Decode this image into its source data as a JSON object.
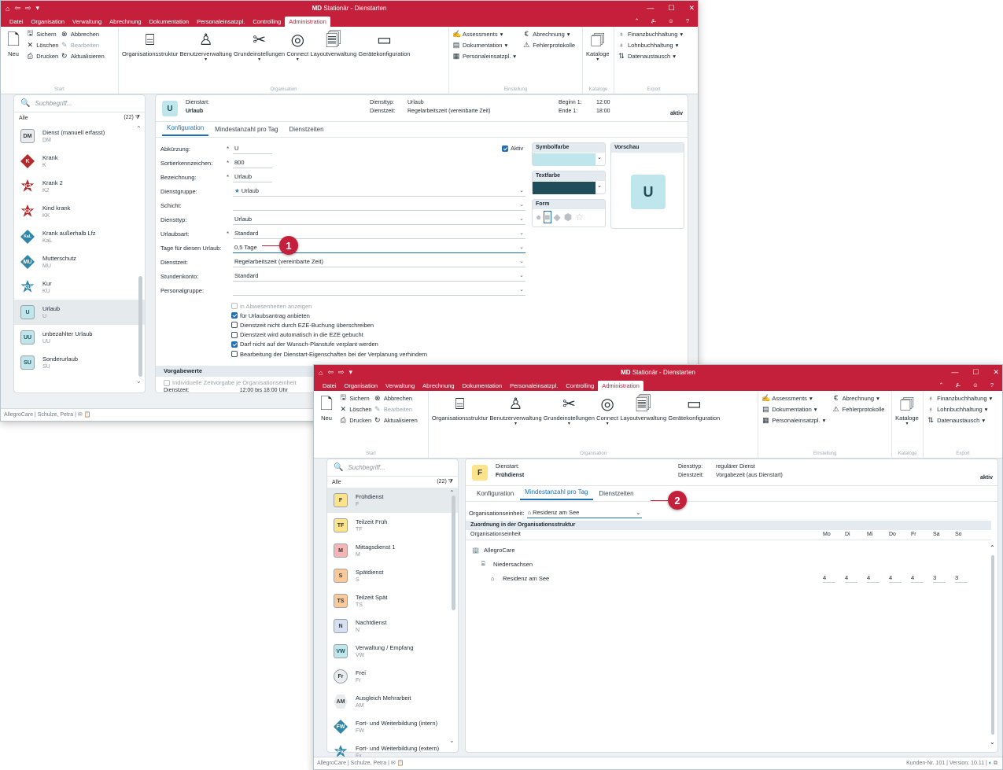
{
  "app": {
    "title_bold": "MD",
    "title_rest": " Stationär - Dienstarten",
    "menu": [
      "Datei",
      "Organisation",
      "Verwaltung",
      "Abrechnung",
      "Dokumentation",
      "Personaleinsatzpl.",
      "Controlling",
      "Administration"
    ],
    "menu_active": "Administration",
    "ribbon": {
      "neu": "Neu",
      "sichern": "Sichern",
      "abbrechen": "Abbrechen",
      "loeschen": "Löschen",
      "bearbeiten": "Bearbeiten",
      "drucken": "Drucken",
      "aktualisieren": "Aktualisieren",
      "group_start": "Start",
      "organisationsstruktur": "Organisationsstruktur",
      "benutzerverwaltung": "Benutzerverwaltung",
      "grundeinstellungen": "Grundeinstellungen",
      "connect": "Connect",
      "layoutverwaltung": "Layoutverwaltung",
      "geraetekonfiguration": "Gerätekonfiguration",
      "group_organisation": "Organisation",
      "assessments": "Assessments",
      "dokumentation": "Dokumentation",
      "personaleinsatzpl": "Personaleinsatzpl.",
      "abrechnung": "Abrechnung",
      "fehlerprotokolle": "Fehlerprotokolle",
      "group_einstellung": "Einstellung",
      "kataloge": "Kataloge",
      "group_kataloge": "Kataloge",
      "finanzbuchhaltung": "Finanzbuchhaltung",
      "lohnbuchhaltung": "Lohnbuchhaltung",
      "datenaustausch": "Datenaustausch",
      "group_export": "Export"
    },
    "status_user": "AllegroCare | Schulze, Petra |",
    "status_right": "Kunden-Nr. 101 | Version: 10.11 |"
  },
  "search_placeholder": "Suchbegriff...",
  "filter_label": "Alle",
  "filter_count": "(22)",
  "w1": {
    "list": [
      {
        "name": "Dienst (manuell erfasst)",
        "code": "DM",
        "badge": "DM",
        "shape": "square",
        "bg": "#e9ecee",
        "fg": "#333333"
      },
      {
        "name": "Krank",
        "code": "K",
        "badge": "K",
        "shape": "diamond",
        "bg": "#b32a2a",
        "fg": "#ffffff"
      },
      {
        "name": "Krank 2",
        "code": "K2",
        "badge": "K2",
        "shape": "star",
        "bg": "#b32a2a",
        "fg": "#ffffff"
      },
      {
        "name": "Kind krank",
        "code": "KK",
        "badge": "KK",
        "shape": "star",
        "bg": "#b32a2a",
        "fg": "#ffffff"
      },
      {
        "name": "Krank außerhalb Lfz",
        "code": "KaL",
        "badge": "KaL",
        "shape": "diamond",
        "bg": "#2f86a6",
        "fg": "#ffffff"
      },
      {
        "name": "Mutterschutz",
        "code": "MU",
        "badge": "MU",
        "shape": "diamond",
        "bg": "#2f86a6",
        "fg": "#ffffff"
      },
      {
        "name": "Kur",
        "code": "KU",
        "badge": "KU",
        "shape": "star",
        "bg": "#2f86a6",
        "fg": "#ffffff"
      },
      {
        "name": "Urlaub",
        "code": "U",
        "badge": "U",
        "shape": "square",
        "bg": "#bfe6ea",
        "fg": "#1f4e5a"
      },
      {
        "name": "unbezahlter Urlaub",
        "code": "UU",
        "badge": "UU",
        "shape": "square",
        "bg": "#bfe6ea",
        "fg": "#1f4e5a"
      },
      {
        "name": "Sonderurlaub",
        "code": "SU",
        "badge": "SU",
        "shape": "square",
        "bg": "#bfe6ea",
        "fg": "#1f4e5a"
      }
    ],
    "selected_index": 7,
    "header": {
      "badge": "U",
      "dienstart_label": "Dienstart:",
      "dienstart_value": "Urlaub",
      "diensttyp_label": "Diensttyp:",
      "diensttyp_value": "Urlaub",
      "dienstzeit_label": "Dienstzeit:",
      "dienstzeit_value": "Regelarbeitszeit (vereinbarte Zeit)",
      "beginn_label": "Beginn 1:",
      "beginn_value": "12:00",
      "ende_label": "Ende 1:",
      "ende_value": "18:00",
      "status": "aktiv"
    },
    "tabs": [
      "Konfiguration",
      "Mindestanzahl pro Tag",
      "Dienstzeiten"
    ],
    "active_tab": 0,
    "form": {
      "abkuerzung_label": "Abkürzung:",
      "abkuerzung": "U",
      "aktiv_label": "Aktiv",
      "sort_label": "Sortierkennzeichen:",
      "sort": "800",
      "bez_label": "Bezeichnung:",
      "bez": "Urlaub",
      "gruppe_label": "Dienstgruppe:",
      "gruppe": "Urlaub",
      "schicht_label": "Schicht:",
      "schicht": "",
      "typ_label": "Diensttyp:",
      "typ": "Urlaub",
      "urlaubsart_label": "Urlaubsart:",
      "urlaubsart": "Standard",
      "tage_label": "Tage für diesen Urlaub:",
      "tage": "0,5 Tage",
      "dienstzeit_label": "Dienstzeit:",
      "dienstzeit": "Regelarbeitszeit (vereinbarte Zeit)",
      "konto_label": "Stundenkonto:",
      "konto": "Standard",
      "personal_label": "Personalgruppe:",
      "personal": ""
    },
    "checks": [
      {
        "label": "in Abwesenheiten anzeigen",
        "state": "disabled-on"
      },
      {
        "label": "für Urlaubsantrag anbieten",
        "state": "on"
      },
      {
        "label": "Dienstzeit nicht durch EZE-Buchung überschreiben",
        "state": "off"
      },
      {
        "label": "Dienstzeit wird automatisch in die EZE gebucht",
        "state": "off"
      },
      {
        "label": "Darf nicht auf der Wunsch-Planstufe verplant werden",
        "state": "on"
      },
      {
        "label": "Bearbeitung der Dienstart-Eigenschaften bei der Verplanung verhindern",
        "state": "off"
      }
    ],
    "vorgabe_title": "Vorgabewerte",
    "vorgabe_check": "Individuelle Zeitvorgabe je Organisationseinheit",
    "vorgabe_row": "Dienstzeit:",
    "vorgabe_time": "12:00   bis   18:00   Uhr",
    "symbolfarbe_label": "Symbolfarbe",
    "symbolfarbe": "#bfe6ea",
    "textfarbe_label": "Textfarbe",
    "textfarbe": "#1f4e5a",
    "form_label": "Form",
    "vorschau_label": "Vorschau",
    "vorschau_badge": "U",
    "callout": "1"
  },
  "w2": {
    "list": [
      {
        "name": "Frühdienst",
        "code": "F",
        "badge": "F",
        "shape": "square",
        "bg": "#fde38a",
        "fg": "#333333"
      },
      {
        "name": "Teilzeit Früh",
        "code": "TF",
        "badge": "TF",
        "shape": "square",
        "bg": "#fde38a",
        "fg": "#333333"
      },
      {
        "name": "Mittagsdienst 1",
        "code": "M",
        "badge": "M",
        "shape": "square",
        "bg": "#f5b5b5",
        "fg": "#333333"
      },
      {
        "name": "Spätdienst",
        "code": "S",
        "badge": "S",
        "shape": "square",
        "bg": "#f9c99a",
        "fg": "#333333"
      },
      {
        "name": "Teilzeit Spät",
        "code": "TS",
        "badge": "TS",
        "shape": "square",
        "bg": "#f9c99a",
        "fg": "#333333"
      },
      {
        "name": "Nachtdienst",
        "code": "N",
        "badge": "N",
        "shape": "square",
        "bg": "#d7e0f2",
        "fg": "#333333"
      },
      {
        "name": "Verwaltung / Empfang",
        "code": "VW",
        "badge": "VW",
        "shape": "square",
        "bg": "#bfe6ea",
        "fg": "#1f4e5a"
      },
      {
        "name": "Frei",
        "code": "Fr",
        "badge": "Fr",
        "shape": "circle",
        "bg": "#e9ecee",
        "fg": "#333333"
      },
      {
        "name": "Ausgleich Mehrarbeit",
        "code": "AM",
        "badge": "AM",
        "shape": "hex",
        "bg": "#e9ecee",
        "fg": "#333333"
      },
      {
        "name": "Fort- und Weiterbildung (intern)",
        "code": "FW",
        "badge": "FW",
        "shape": "diamond",
        "bg": "#2f86a6",
        "fg": "#ffffff"
      },
      {
        "name": "Fort- und Weiterbildung (extern)",
        "code": "Fx",
        "badge": "Fx",
        "shape": "star",
        "bg": "#2f86a6",
        "fg": "#ffffff"
      }
    ],
    "selected_index": 0,
    "header": {
      "badge": "F",
      "dienstart_label": "Dienstart:",
      "dienstart_value": "Frühdienst",
      "diensttyp_label": "Diensttyp:",
      "diensttyp_value": "regulärer Dienst",
      "dienstzeit_label": "Dienstzeit:",
      "dienstzeit_value": "Vorgabezeit (aus Dienstart)",
      "status": "aktiv"
    },
    "tabs": [
      "Konfiguration",
      "Mindestanzahl pro Tag",
      "Dienstzeiten"
    ],
    "active_tab": 1,
    "org_label": "Organisationseinheit:",
    "org_value": "Residenz am See",
    "section_title": "Zuordnung in der Organisationsstruktur",
    "col_org": "Organisationseinheit",
    "days": [
      "Mo",
      "Di",
      "Mi",
      "Do",
      "Fr",
      "Sa",
      "So"
    ],
    "tree": [
      {
        "label": "AllegroCare",
        "level": 0,
        "icon": "building"
      },
      {
        "label": "Niedersachsen",
        "level": 1,
        "icon": "hierarchy"
      },
      {
        "label": "Residenz am See",
        "level": 2,
        "icon": "house",
        "counts": [
          "4",
          "4",
          "4",
          "4",
          "4",
          "3",
          "3"
        ]
      }
    ],
    "callout": "2"
  }
}
